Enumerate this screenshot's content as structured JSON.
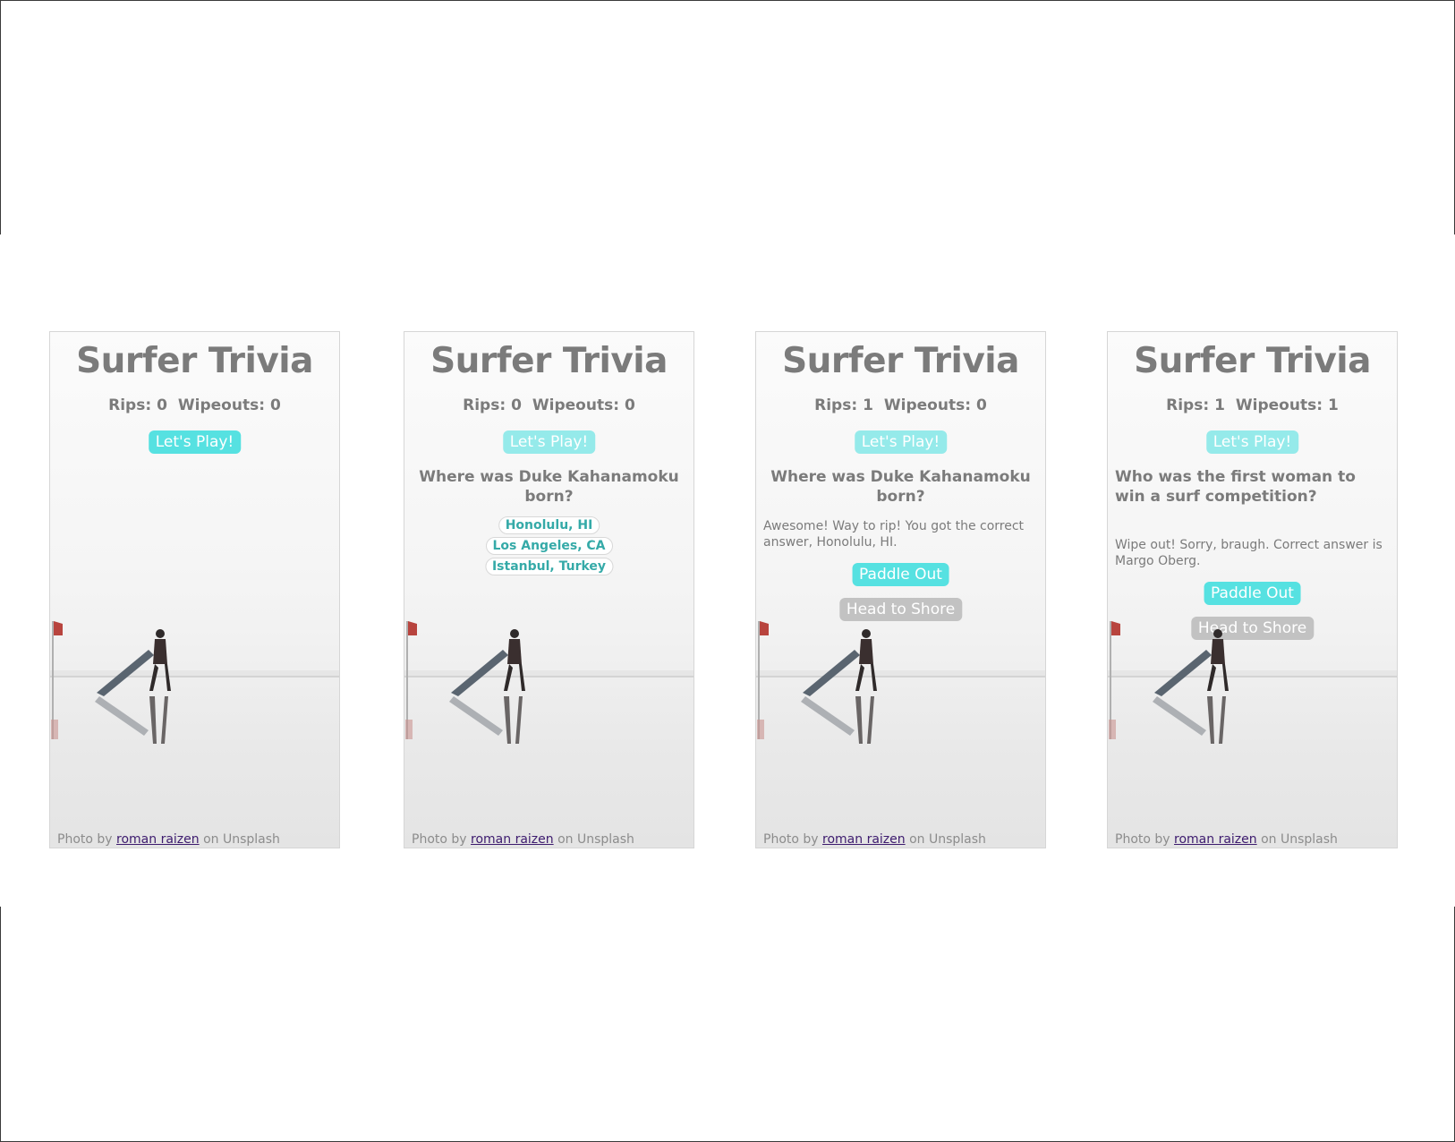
{
  "app_title": "Surfer Trivia",
  "credit": {
    "prefix": "Photo by",
    "author": "roman raizen",
    "suffix": "on Unsplash"
  },
  "buttons": {
    "play": "Let's Play!",
    "paddle": "Paddle Out",
    "shore": "Head to Shore"
  },
  "score_labels": {
    "rips": "Rips:",
    "wipeouts": "Wipeouts:"
  },
  "colors": {
    "accent": "#56e1e1",
    "answer_text": "#35aaa8",
    "muted": "#c2c2c2"
  },
  "screens": [
    {
      "rips": "0",
      "wipeouts": "0"
    },
    {
      "rips": "0",
      "wipeouts": "0",
      "question": "Where was Duke Kahanamoku born?",
      "answers": [
        "Honolulu, HI",
        "Los Angeles, CA",
        "Istanbul, Turkey"
      ]
    },
    {
      "rips": "1",
      "wipeouts": "0",
      "question": "Where was Duke Kahanamoku born?",
      "feedback": "Awesome! Way to rip! You got the correct answer, Honolulu, HI."
    },
    {
      "rips": "1",
      "wipeouts": "1",
      "question": "Who was the first woman to win a surf competition?",
      "feedback": "Wipe out! Sorry, braugh. Correct answer is Margo Oberg."
    }
  ]
}
